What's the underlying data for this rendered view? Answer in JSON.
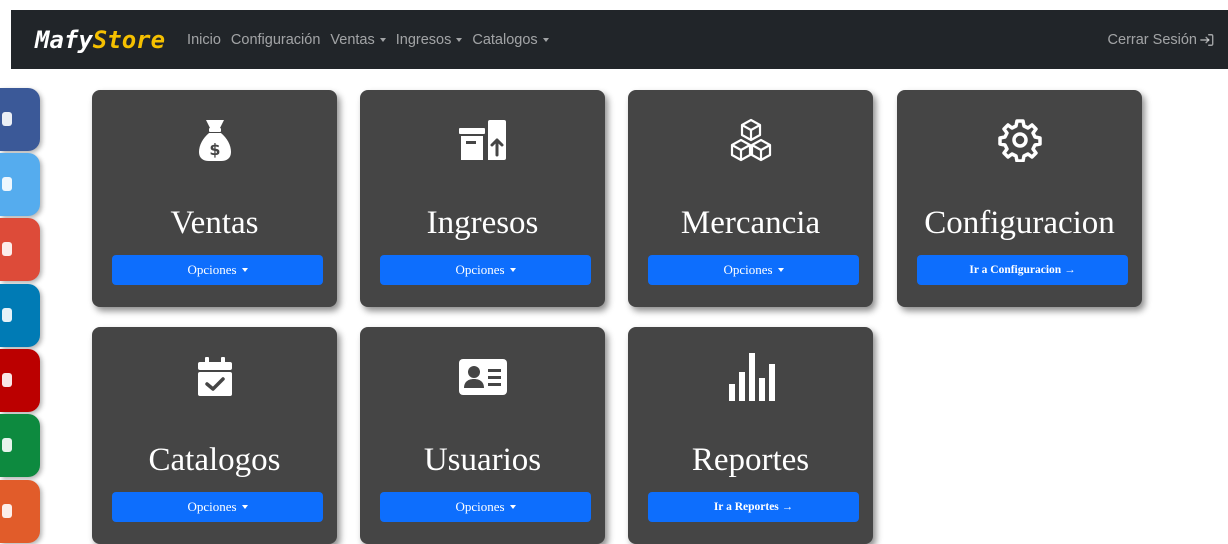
{
  "navbar": {
    "brand_a": "Mafy",
    "brand_b": "Store",
    "items": [
      {
        "label": "Inicio"
      },
      {
        "label": "Configuración"
      },
      {
        "label": "Ventas"
      },
      {
        "label": "Ingresos"
      },
      {
        "label": "Catalogos"
      }
    ],
    "logout_label": "Cerrar Sesión"
  },
  "social_colors": [
    "#3b5998",
    "#55acee",
    "#dd4b39",
    "#007bb5",
    "#bb0000",
    "#0d8a3f",
    "#e15c2a"
  ],
  "cards": [
    {
      "title": "Ventas",
      "button": "Opciones",
      "icon": "money-bag-icon"
    },
    {
      "title": "Ingresos",
      "button": "Opciones",
      "icon": "box-upload-icon"
    },
    {
      "title": "Mercancia",
      "button": "Opciones",
      "icon": "cubes-icon"
    },
    {
      "title": "Configuracion",
      "button": "Ir a Configuracion →",
      "icon": "gear-icon"
    },
    {
      "title": "Catalogos",
      "button": "Opciones",
      "icon": "calendar-check-icon"
    },
    {
      "title": "Usuarios",
      "button": "Opciones",
      "icon": "id-card-icon"
    },
    {
      "title": "Reportes",
      "button": "Ir a Reportes →",
      "icon": "bar-chart-icon"
    }
  ]
}
